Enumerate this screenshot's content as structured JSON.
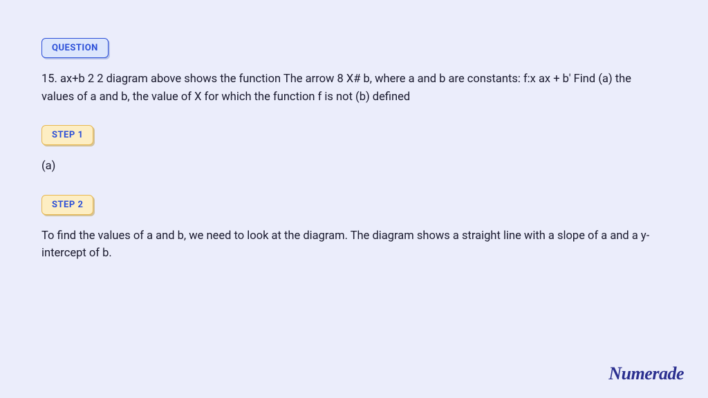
{
  "question": {
    "badge": "QUESTION",
    "text": "15. ax+b 2 2 diagram above shows the function The arrow 8 X# b, where a and b are constants: f:x ax + b' Find (a) the values of a and b, the value of X for which the function f is not (b) defined"
  },
  "steps": [
    {
      "badge": "STEP 1",
      "content": "(a)"
    },
    {
      "badge": "STEP 2",
      "content": "To find the values of a and b, we need to look at the diagram. The diagram shows a straight line with a slope of a and a y-intercept of b."
    }
  ],
  "brand": "Numerade"
}
